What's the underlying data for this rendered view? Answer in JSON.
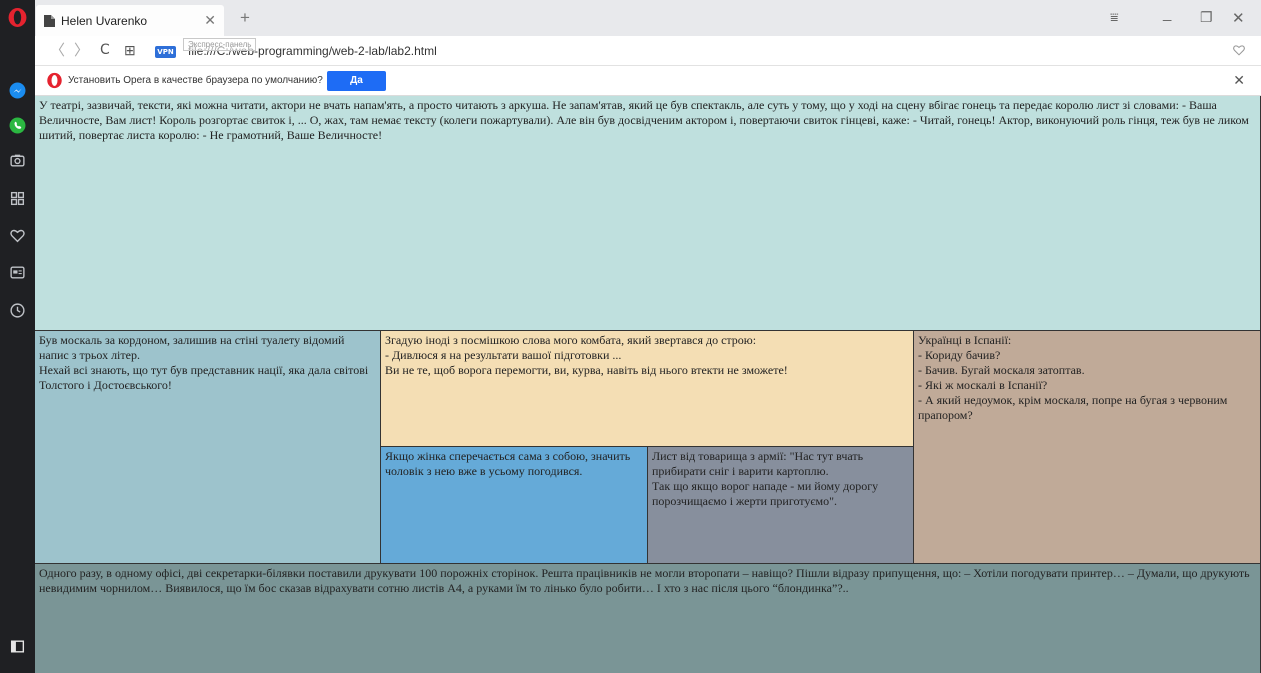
{
  "browser": {
    "tab_title": "Helen Uvarenko",
    "tab_close": "✕",
    "new_tab": "+",
    "url": "file:///C:/web-programming/web-2-lab/lab2.html",
    "tooltip": "Экспресс-панель",
    "vpn_label": "VPN",
    "window_controls": {
      "menu": "⩸",
      "minimize": "_",
      "restore": "❐",
      "close": "✕"
    },
    "nav": {
      "back": "〈",
      "forward": "〉",
      "reload": "C",
      "speed_dial": "⊞"
    }
  },
  "notification": {
    "text": "Установить Opera в качестве браузера по умолчанию?",
    "button": "Да",
    "close": "✕"
  },
  "sidebar": {
    "icons": [
      "opera-logo",
      "messenger-icon",
      "whatsapp-icon",
      "camera-icon",
      "grid-icon",
      "heart-icon",
      "news-icon",
      "history-icon",
      "sidebar-toggle-icon"
    ]
  },
  "colors": {
    "top": "#bfe0de",
    "left": "#9dc3cc",
    "center_top": "#f4deb4",
    "right": "#c0aa98",
    "mid_left": "#65aad8",
    "mid_right": "#878f9d",
    "bottom": "#7a9596"
  },
  "content": {
    "top": "У театрі, зазвичай, тексти, які можна читати, актори не вчать напам'ять, а просто читають з аркуша. Не запам'ятав, який це був спектакль, але суть у тому, що у ході на сцену вбігає гонець та передає королю лист зі словами: - Ваша Величносте, Вам лист! Король розгортає свиток і, ... О, жах, там немає тексту (колеги пожартували). Але він був досвідченим актором і, повертаючи свиток гінцеві, каже: - Читай, гонець! Актор, виконуючий роль гінця, теж був не ликом шитий, повертає листа королю: - Не грамотний, Ваше Величносте!",
    "left": [
      "Був москаль за кордоном, залишив на стіні туалету відомий напис з трьох літер.",
      "Нехай всі знають, що тут був представник нації, яка дала світові Толстого і Достоєвського!"
    ],
    "center_top": [
      "Згадую іноді з посмішкою слова мого комбата, який звертався до строю:",
      "- Дивлюся я на результати вашої підготовки ...",
      "Ви не те, щоб ворога перемогти, ви, курва, навіть від нього втекти не зможете!"
    ],
    "right": [
      "Українці в Іспанії:",
      "- Кориду бачив?",
      "- Бачив. Бугай москаля затоптав.",
      "- Які ж москалі в Іспанії?",
      "- А який недоумок, крім москаля, попре на бугая з червоним прапором?"
    ],
    "mid_left": "Якщо жінка сперечається сама з собою, значить чоловік з нею вже в усьому погодився.",
    "mid_right": [
      "Лист від товарища з армії: \"Нас тут вчать прибирати сніг і варити картоплю.",
      "Так що якщо ворог нападе - ми йому дорогу порозчищаємо і жерти приготуємо\"."
    ],
    "bottom": "Одного разу, в одному офісі, дві секретарки-білявки поставили друкувати 100 порожніх сторінок. Решта працівників не могли второпати – навіщо? Пішли відразу припущення, що: – Хотіли погодувати принтер… – Думали, що друкують невидимим чорнилом… Виявилося, що їм бос сказав відрахувати сотню листів А4, а руками їм то лінько було робити… І хто з нас після цього “блондинка”?.."
  }
}
